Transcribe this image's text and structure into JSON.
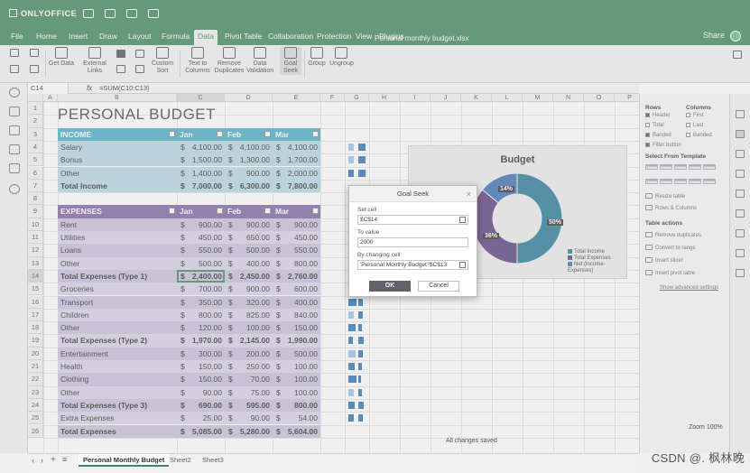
{
  "app": {
    "brand": "ONLYOFFICE",
    "document_title": "Personal monthly budget.xlsx",
    "accent_color": "#40865c",
    "share_label": "Share"
  },
  "tabs": [
    "File",
    "Home",
    "Insert",
    "Draw",
    "Layout",
    "Formula",
    "Data",
    "Pivot Table",
    "Collaboration",
    "Protection",
    "View",
    "Plugins"
  ],
  "active_tab": "Data",
  "toolbar": {
    "get_data": "Get Data",
    "external_links": "External Links",
    "custom_sort": "Custom Sort",
    "text_to_columns": "Text to Columns",
    "remove_duplicates": "Remove Duplicates",
    "data_validation": "Data Validation",
    "goal_seek": "Goal Seek",
    "group": "Group",
    "ungroup": "Ungroup",
    "view_settings": "View settings"
  },
  "formula_bar": {
    "cell_ref": "C14",
    "fx": "fx",
    "formula": "=SUM(C10:C13)"
  },
  "columns": [
    "A",
    "B",
    "C",
    "D",
    "E",
    "F",
    "G",
    "H",
    "I",
    "J",
    "K",
    "L",
    "M",
    "N",
    "O",
    "P"
  ],
  "rows": [
    "1",
    "2",
    "3",
    "4",
    "5",
    "6",
    "7",
    "8",
    "9",
    "10",
    "11",
    "12",
    "13",
    "14",
    "15",
    "16",
    "17",
    "18",
    "19",
    "20",
    "21",
    "22",
    "23",
    "24",
    "25",
    "26"
  ],
  "sheet": {
    "title": "PERSONAL BUDGET",
    "months": [
      "Jan",
      "Feb",
      "Mar"
    ],
    "currency": "$",
    "income_header": "INCOME",
    "income": [
      {
        "label": "Salary",
        "v": [
          "4,100.00",
          "4,100.00",
          "4,100.00"
        ]
      },
      {
        "label": "Bonus",
        "v": [
          "1,500.00",
          "1,300.00",
          "1,700.00"
        ]
      },
      {
        "label": "Other",
        "v": [
          "1,400.00",
          "900.00",
          "2,000.00"
        ]
      },
      {
        "label": "Total Income",
        "v": [
          "7,000.00",
          "6,300.00",
          "7,800.00"
        ]
      }
    ],
    "expenses_header": "EXPENSES",
    "expenses": [
      {
        "label": "Rent",
        "v": [
          "900.00",
          "900.00",
          "900.00"
        ]
      },
      {
        "label": "Utilities",
        "v": [
          "450.00",
          "650.00",
          "450.00"
        ]
      },
      {
        "label": "Loans",
        "v": [
          "550.00",
          "500.00",
          "550.00"
        ]
      },
      {
        "label": "Other",
        "v": [
          "500.00",
          "400.00",
          "800.00"
        ]
      },
      {
        "label": "Total Expenses (Type 1)",
        "v": [
          "2,400.00",
          "2,450.00",
          "2,760.00"
        ]
      },
      {
        "label": "Groceries",
        "v": [
          "700.00",
          "900.00",
          "600.00"
        ]
      },
      {
        "label": "Transport",
        "v": [
          "350.00",
          "320.00",
          "400.00"
        ]
      },
      {
        "label": "Children",
        "v": [
          "800.00",
          "825.00",
          "840.00"
        ]
      },
      {
        "label": "Other",
        "v": [
          "120.00",
          "100.00",
          "150.00"
        ]
      },
      {
        "label": "Total Expenses (Type 2)",
        "v": [
          "1,970.00",
          "2,145.00",
          "1,990.00"
        ]
      },
      {
        "label": "Entertainment",
        "v": [
          "300.00",
          "200.00",
          "500.00"
        ]
      },
      {
        "label": "Health",
        "v": [
          "150.00",
          "250.00",
          "100.00"
        ]
      },
      {
        "label": "Clothing",
        "v": [
          "150.00",
          "70.00",
          "100.00"
        ]
      },
      {
        "label": "Other",
        "v": [
          "90.00",
          "75.00",
          "100.00"
        ]
      },
      {
        "label": "Total Expenses (Type 3)",
        "v": [
          "690.00",
          "595.00",
          "800.00"
        ]
      },
      {
        "label": "Extra Expenses",
        "v": [
          "25.00",
          "90.00",
          "54.00"
        ]
      },
      {
        "label": "Total Expenses",
        "v": [
          "5,085.00",
          "5,280.00",
          "5,604.00"
        ]
      }
    ]
  },
  "chart": {
    "title": "Budget",
    "labels": [
      "14%",
      "36%",
      "50%"
    ],
    "legend": [
      "Total Income",
      "Total Expenses",
      "Net (Income-Expenses)"
    ],
    "colors": {
      "income": "#2a7a99",
      "expenses": "#5b3f80",
      "net": "#3d6fb4"
    }
  },
  "dialog": {
    "title": "Goal Seek",
    "set_cell_label": "Set cell",
    "set_cell_value": "$C$14",
    "to_value_label": "To value",
    "to_value_value": "2000",
    "changing_cell_label": "By changing cell",
    "changing_cell_value": "'Personal Monthly Budget'!$C$13",
    "ok": "OK",
    "cancel": "Cancel"
  },
  "right_panel": {
    "rows_head": "Rows",
    "columns_head": "Columns",
    "rows_options": [
      "Header",
      "Total",
      "Banded",
      "Filter button"
    ],
    "cols_options": [
      "First",
      "Last",
      "Banded"
    ],
    "template_head": "Select From Template",
    "resize_table": "Resize table",
    "rows_columns": "Rows & Columns",
    "table_actions_head": "Table actions",
    "remove_duplicates": "Remove duplicates",
    "convert_to_range": "Convert to range",
    "insert_slicer": "Insert slicer",
    "insert_pivot": "Insert pivot table",
    "advanced": "Show advanced settings"
  },
  "sheet_tabs": [
    "Personal Monthly Budget",
    "Sheet2",
    "Sheet3"
  ],
  "status": {
    "saved": "All changes saved",
    "zoom": "Zoom 100%"
  },
  "watermark": "CSDN @. 枫林晚"
}
